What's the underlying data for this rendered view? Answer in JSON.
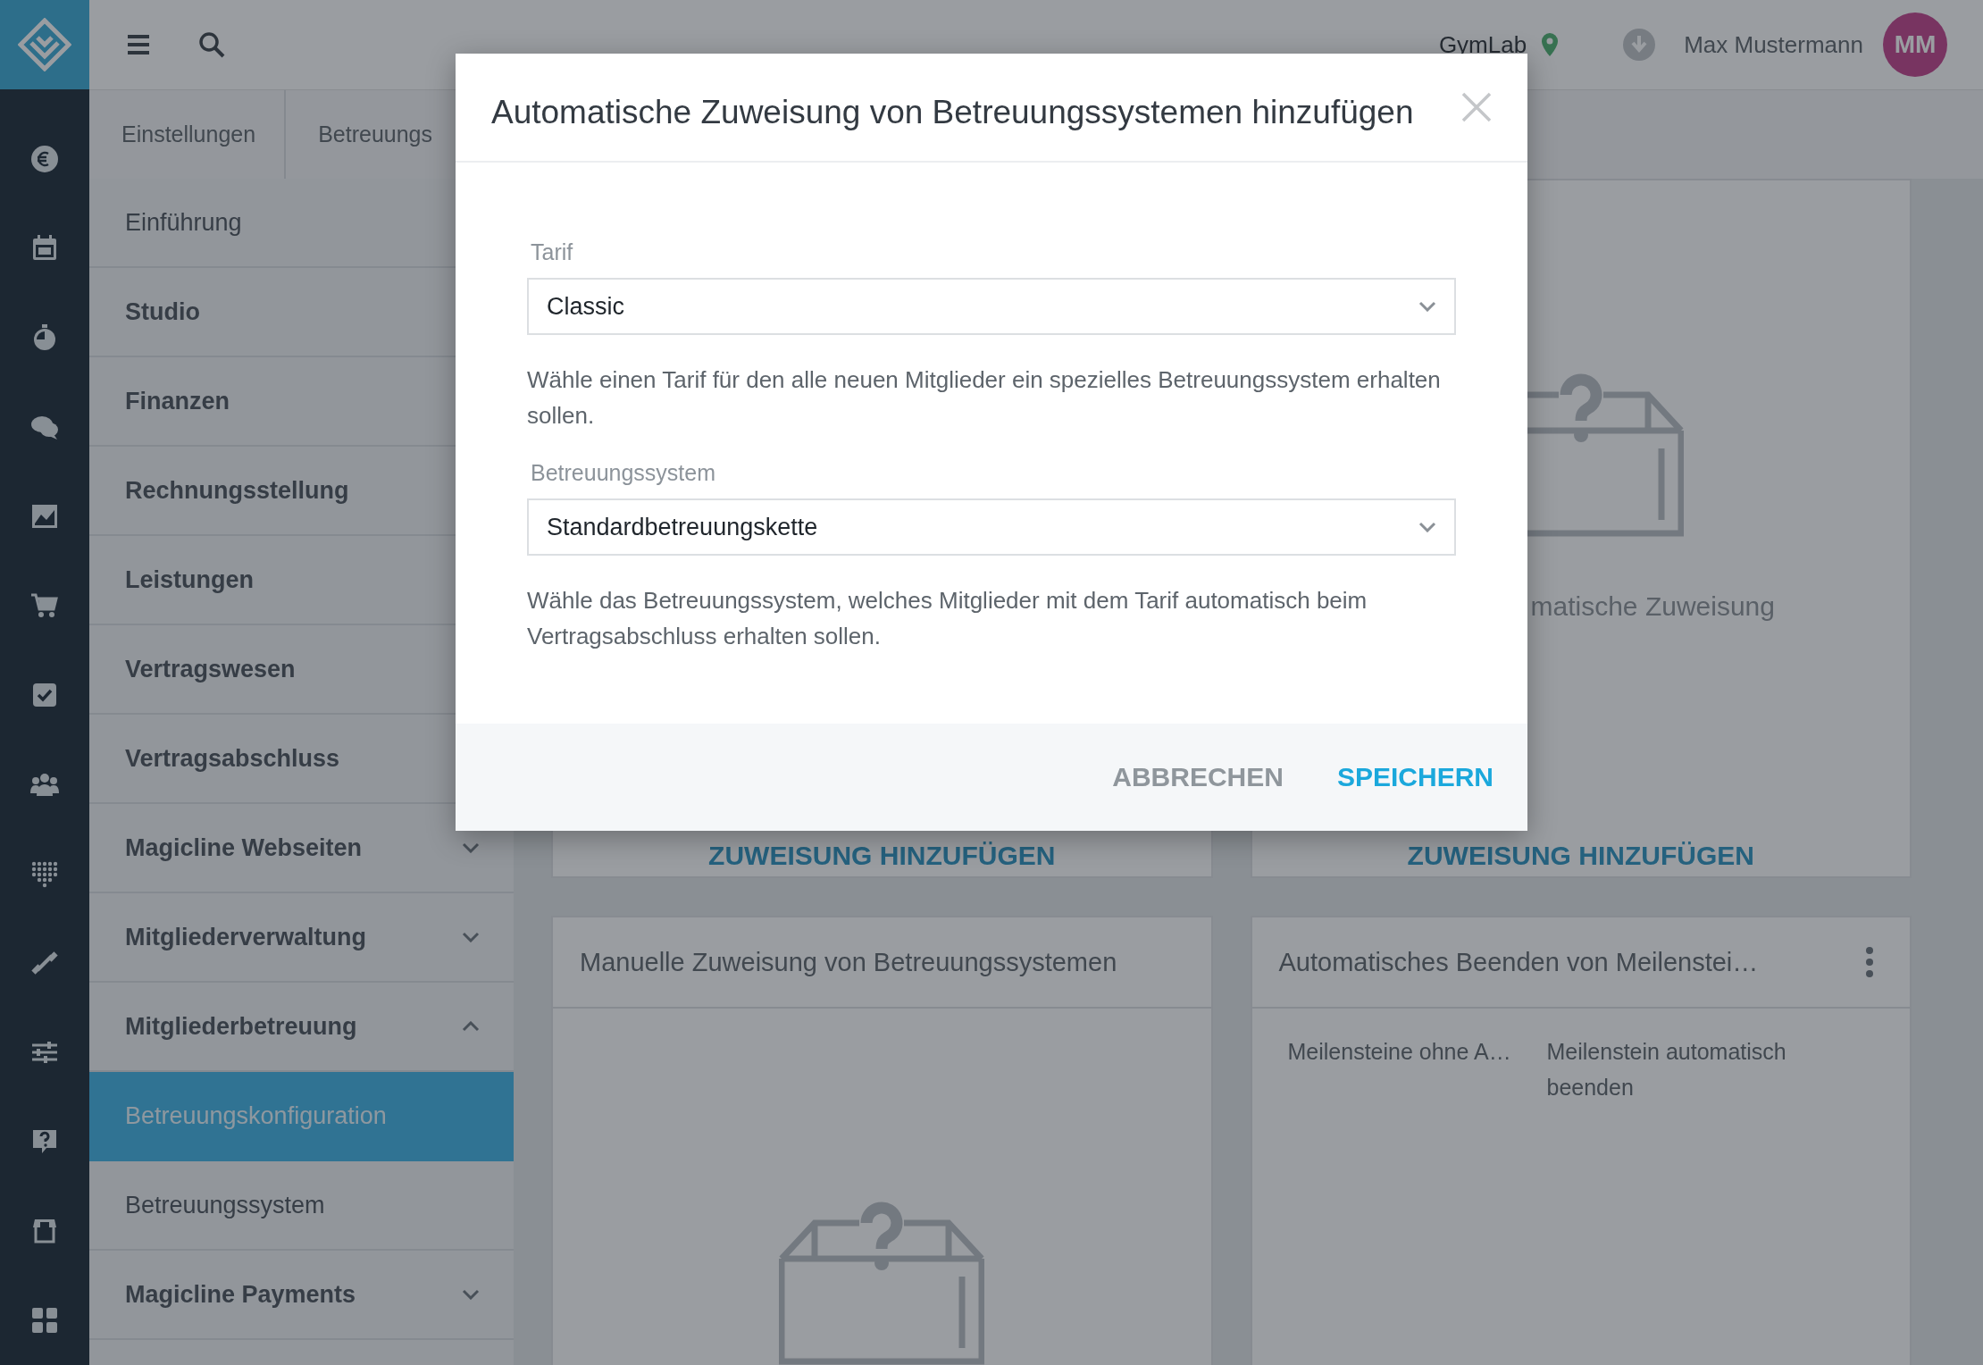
{
  "rail": {
    "items": [
      {
        "kind": "euro"
      },
      {
        "kind": "calendar"
      },
      {
        "kind": "stopwatch"
      },
      {
        "kind": "chat"
      },
      {
        "kind": "chart"
      },
      {
        "kind": "cart"
      },
      {
        "kind": "check"
      },
      {
        "kind": "people"
      },
      {
        "kind": "dots"
      },
      {
        "kind": "dumbbell"
      },
      {
        "kind": "sliders"
      },
      {
        "kind": "help"
      },
      {
        "kind": "store"
      },
      {
        "kind": "grid"
      }
    ]
  },
  "topbar": {
    "location": "GymLab",
    "user": "Max Mustermann",
    "avatar": "MM"
  },
  "breadcrumb": [
    "Einstellungen",
    "Betreuungs"
  ],
  "sidebar": {
    "items": [
      {
        "label": "Einführung",
        "kind": "page",
        "selected": false
      },
      {
        "label": "Studio",
        "kind": "section",
        "selected": false
      },
      {
        "label": "Finanzen",
        "kind": "section",
        "selected": false
      },
      {
        "label": "Rechnungsstellung",
        "kind": "section",
        "selected": false
      },
      {
        "label": "Leistungen",
        "kind": "section",
        "selected": false
      },
      {
        "label": "Vertragswesen",
        "kind": "section",
        "selected": false
      },
      {
        "label": "Vertragsabschluss",
        "kind": "section",
        "selected": false
      },
      {
        "label": "Magicline Webseiten",
        "kind": "section",
        "selected": false,
        "expanded": false
      },
      {
        "label": "Mitgliederverwaltung",
        "kind": "section",
        "selected": false,
        "expanded": false
      },
      {
        "label": "Mitgliederbetreuung",
        "kind": "section",
        "selected": false,
        "expanded": true,
        "children": [
          {
            "label": "Betreuungskonfiguration",
            "kind": "page",
            "selected": true
          },
          {
            "label": "Betreuungssystem",
            "kind": "page",
            "selected": false
          }
        ]
      },
      {
        "label": "Magicline Payments",
        "kind": "section",
        "selected": false,
        "expanded": false
      }
    ]
  },
  "cards": [
    {
      "kind": "empty",
      "button": "ZUWEISUNG HINZUFÜGEN"
    },
    {
      "kind": "empty",
      "empty_text": "matische Zuweisung",
      "button": "ZUWEISUNG HINZUFÜGEN"
    },
    {
      "kind": "empty",
      "title": "Manuelle Zuweisung von Betreuungssystemen"
    },
    {
      "kind": "table",
      "title": "Automatisches Beenden von Meilenstei…",
      "columns": [
        "Meilensteine ohne A…",
        "Meilenstein automatisch beenden"
      ]
    }
  ],
  "dialog": {
    "title": "Automatische Zuweisung von Betreuungssystemen hinzufügen",
    "fields": [
      {
        "label": "Tarif",
        "value": "Classic",
        "hint": "Wähle einen Tarif für den alle neuen Mitglieder ein spezielles Betreuungssystem erhalten sollen."
      },
      {
        "label": "Betreuungssystem",
        "value": "Standardbetreuungskette",
        "hint": "Wähle das Betreuungssystem, welches Mitglieder mit dem Tarif automatisch beim Vertragsabschluss erhalten sollen."
      }
    ],
    "buttons": [
      {
        "label": "ABBRECHEN",
        "kind": "secondary"
      },
      {
        "label": "SPEICHERN",
        "kind": "primary"
      }
    ]
  }
}
